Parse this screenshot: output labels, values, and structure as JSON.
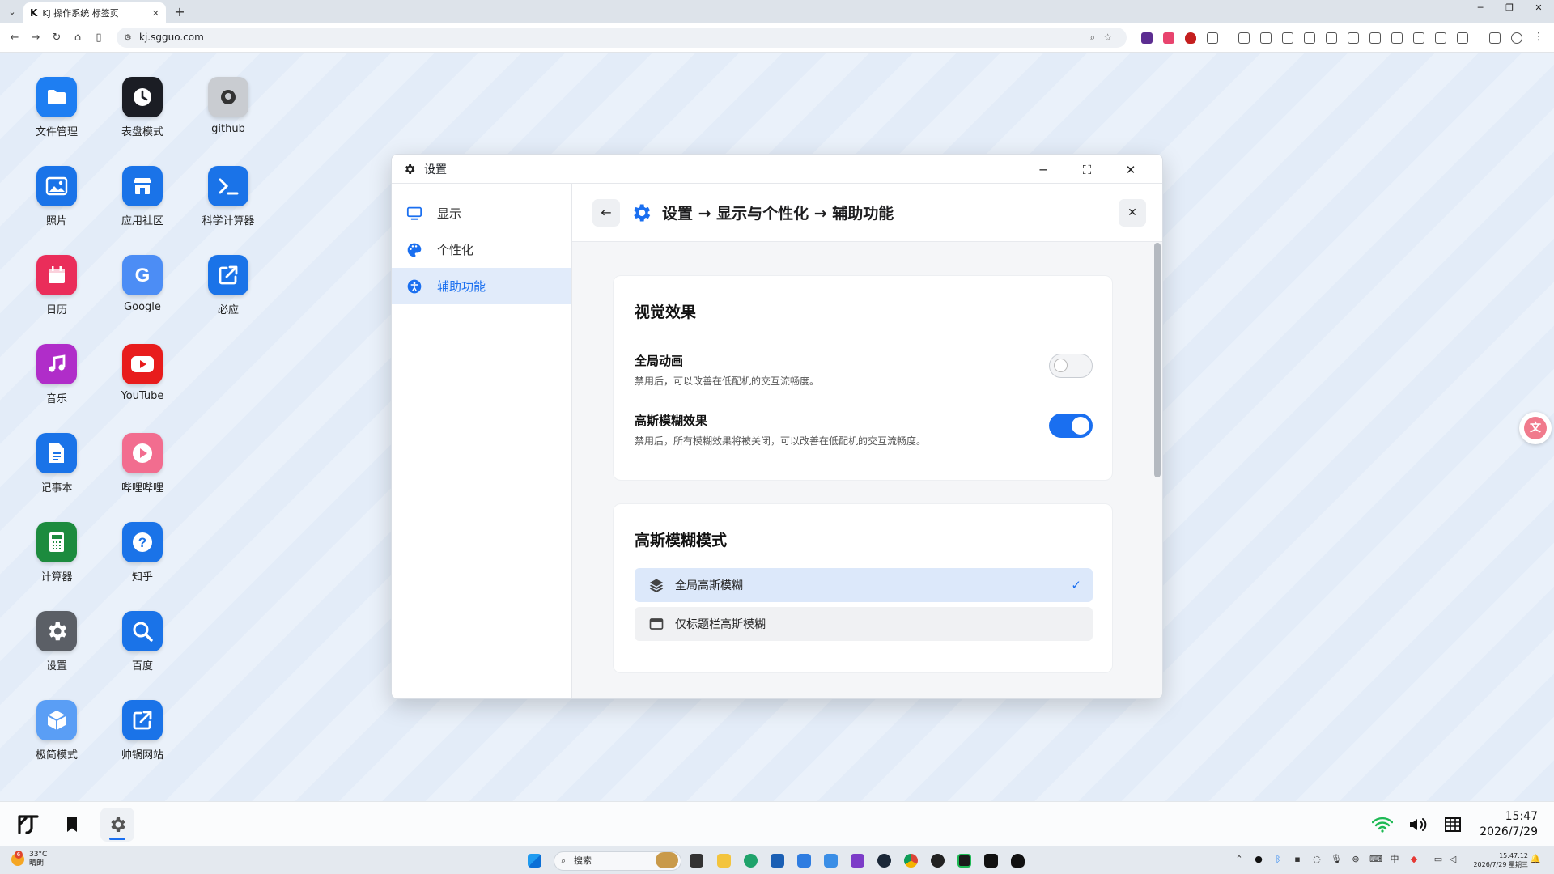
{
  "browser": {
    "tab_title": "KJ 操作系统 标签页",
    "url": "kj.sgguo.com"
  },
  "desktop": {
    "icons": [
      {
        "label": "文件管理",
        "icon": "folder-icon",
        "color": "#1e7ef2"
      },
      {
        "label": "表盘模式",
        "icon": "clock-icon",
        "color": "#1b1d24"
      },
      {
        "label": "github",
        "icon": "github-icon",
        "color": "#c9ccd1"
      },
      {
        "label": "照片",
        "icon": "photo-icon",
        "color": "#1a73e8"
      },
      {
        "label": "应用社区",
        "icon": "store-icon",
        "color": "#1a73e8"
      },
      {
        "label": "科学计算器",
        "icon": "terminal-icon",
        "color": "#1a73e8"
      },
      {
        "label": "日历",
        "icon": "calendar-icon",
        "color": "#ea2d5a"
      },
      {
        "label": "Google",
        "icon": "google-icon",
        "color": "#4c8df5"
      },
      {
        "label": "必应",
        "icon": "external-link-icon",
        "color": "#1a73e8"
      },
      {
        "label": "音乐",
        "icon": "music-icon",
        "color": "#b02dc9"
      },
      {
        "label": "YouTube",
        "icon": "youtube-icon",
        "color": "#e81c1c"
      },
      {
        "label": "记事本",
        "icon": "document-icon",
        "color": "#1a73e8"
      },
      {
        "label": "哔哩哔哩",
        "icon": "play-icon",
        "color": "#f26d8f"
      },
      {
        "label": "计算器",
        "icon": "calculator-icon",
        "color": "#1c8b3e"
      },
      {
        "label": "知乎",
        "icon": "question-icon",
        "color": "#1a73e8"
      },
      {
        "label": "设置",
        "icon": "gear-icon",
        "color": "#5b5f66"
      },
      {
        "label": "百度",
        "icon": "search-icon",
        "color": "#1a73e8"
      },
      {
        "label": "极简模式",
        "icon": "cube-icon",
        "color": "#5a9ef5"
      },
      {
        "label": "帅锅网站",
        "icon": "external-link-icon",
        "color": "#1a73e8"
      }
    ]
  },
  "settings": {
    "window_title": "设置",
    "sidebar": [
      {
        "label": "显示",
        "icon": "monitor-icon"
      },
      {
        "label": "个性化",
        "icon": "palette-icon"
      },
      {
        "label": "辅助功能",
        "icon": "accessibility-icon"
      }
    ],
    "breadcrumb": "设置 → 显示与个性化 → 辅助功能",
    "visual": {
      "title": "视觉效果",
      "anim_title": "全局动画",
      "anim_desc": "禁用后，可以改善在低配机的交互流畅度。",
      "anim_enabled": false,
      "blur_title": "高斯模糊效果",
      "blur_desc": "禁用后，所有模糊效果将被关闭，可以改善在低配机的交互流畅度。",
      "blur_enabled": true
    },
    "blur_mode": {
      "title": "高斯模糊模式",
      "options": [
        {
          "label": "全局高斯模糊",
          "selected": true
        },
        {
          "label": "仅标题栏高斯模糊",
          "selected": false
        }
      ]
    }
  },
  "dock": {
    "time": "15:47",
    "date": "2026/7/29"
  },
  "taskbar": {
    "temp": "33°C",
    "weather": "晴朗",
    "search_placeholder": "搜索",
    "time": "15:47:12",
    "date": "2026/7/29 星期三",
    "badge": "6"
  },
  "colors": {
    "accent": "#1a6ff0"
  }
}
